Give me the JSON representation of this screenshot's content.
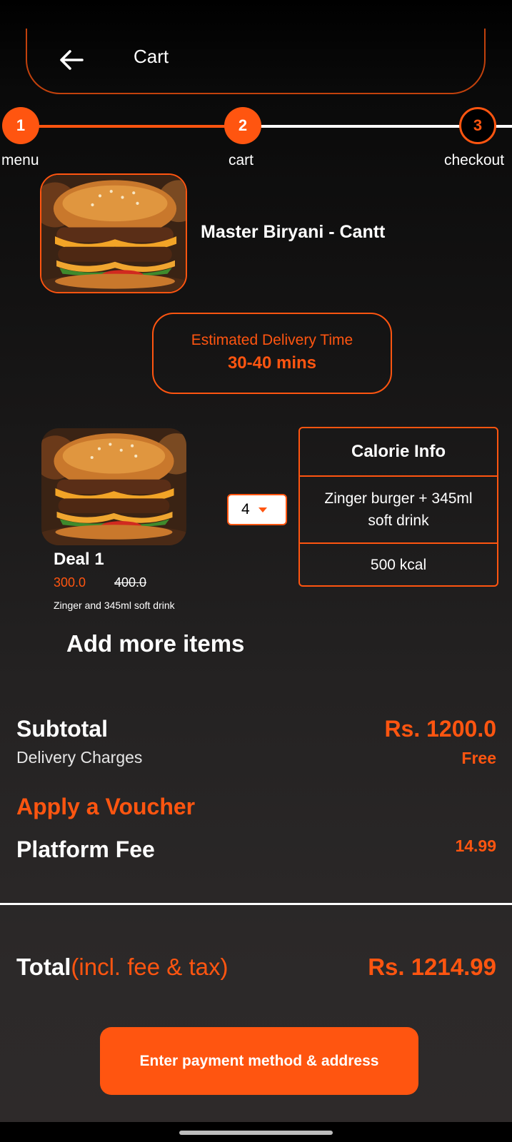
{
  "header": {
    "title": "Cart",
    "back_icon": "arrow-left-icon"
  },
  "stepper": {
    "steps": [
      {
        "number": "1",
        "label": "menu",
        "state": "done"
      },
      {
        "number": "2",
        "label": "cart",
        "state": "done"
      },
      {
        "number": "3",
        "label": "checkout",
        "state": "current"
      }
    ]
  },
  "restaurant": {
    "name": "Master Biryani - Cantt",
    "image": "burger-image"
  },
  "delivery": {
    "label": "Estimated Delivery Time",
    "time": "30-40 mins"
  },
  "cart_item": {
    "name": "Deal 1",
    "price": "300.0",
    "original_price": "400.0",
    "description": "Zinger and 345ml soft drink",
    "quantity": "4",
    "image": "burger-image"
  },
  "calorie_info": {
    "title": "Calorie Info",
    "description": "Zinger burger + 345ml soft drink",
    "kcal": "500 kcal"
  },
  "add_more_label": "Add more items",
  "summary": {
    "subtotal_label": "Subtotal",
    "subtotal_value": "Rs. 1200.0",
    "delivery_label": "Delivery Charges",
    "delivery_value": "Free",
    "voucher_label": "Apply a Voucher",
    "platform_fee_label": "Platform Fee",
    "platform_fee_value": "14.99",
    "total_label": "Total",
    "total_note": "(incl. fee & tax)",
    "total_value": "Rs. 1214.99"
  },
  "pay_button_label": "Enter payment method & address",
  "colors": {
    "accent": "#ff5510",
    "background_top": "#000000",
    "background_bottom": "#2e2a2a"
  }
}
